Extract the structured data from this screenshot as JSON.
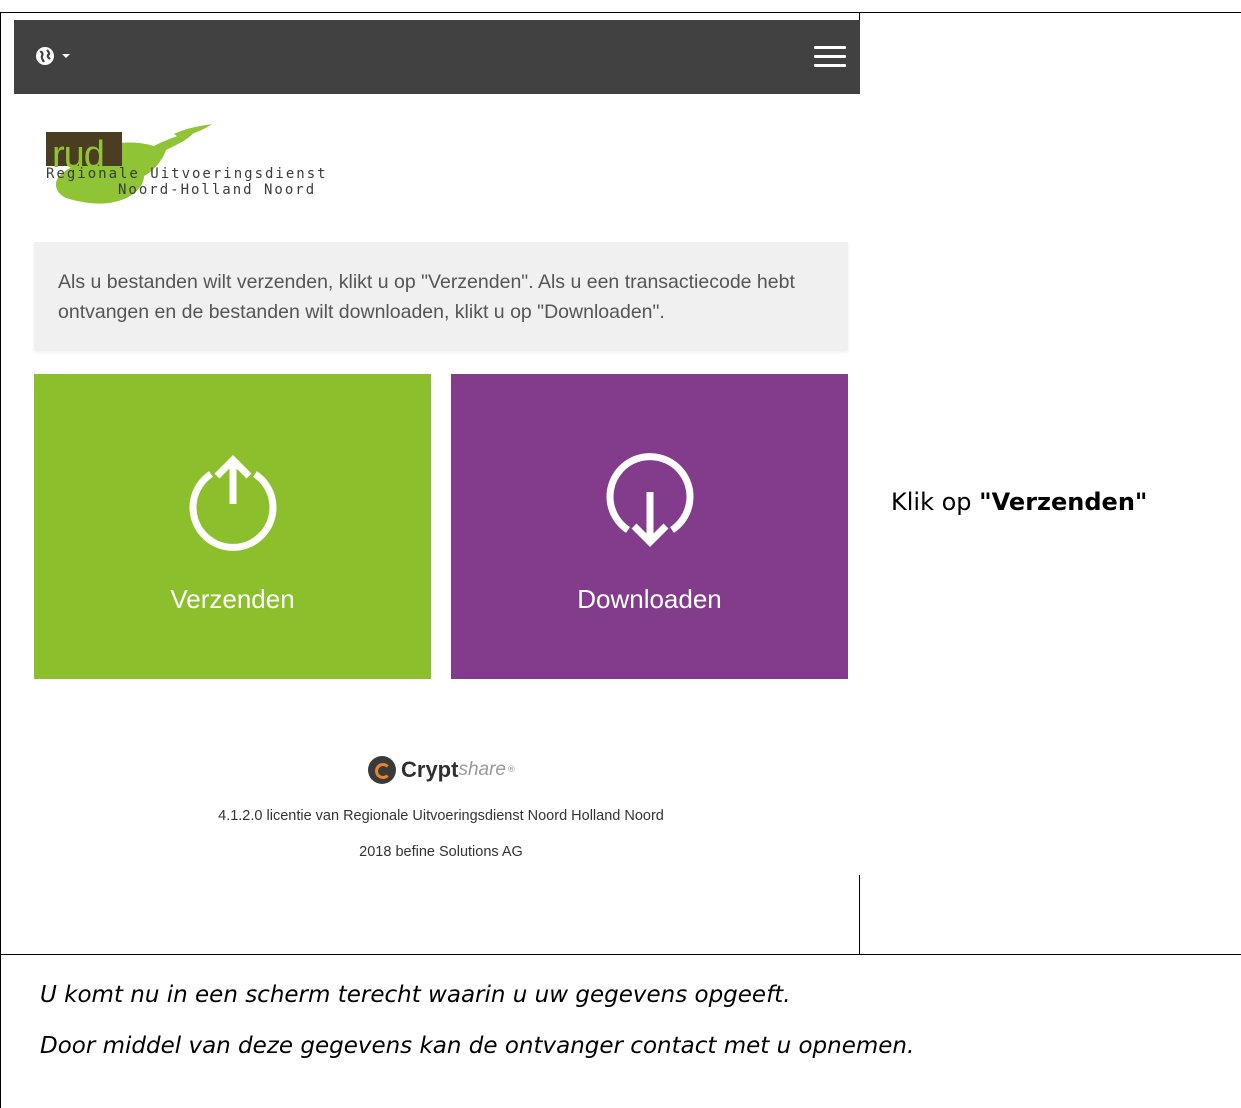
{
  "screenshot": {
    "navbar": {
      "language_icon": "globe-icon",
      "caret_icon": "caret-down-icon",
      "menu_icon": "hamburger-menu-icon"
    },
    "logo": {
      "short": "rud",
      "line1": "Regionale Uitvoeringsdienst",
      "line2": "Noord-Holland Noord"
    },
    "info_text": "Als u bestanden wilt verzenden, klikt u op \"Verzenden\". Als u een transactiecode hebt ontvangen en de bestanden wilt downloaden, klikt u op \"Downloaden\".",
    "tiles": [
      {
        "label": "Verzenden",
        "icon": "upload-icon",
        "color": "#8bbf2b"
      },
      {
        "label": "Downloaden",
        "icon": "download-icon",
        "color": "#833b8c"
      }
    ],
    "footer": {
      "brand_bold": "Crypt",
      "brand_light": "share",
      "brand_mark": "®",
      "license": "4.1.2.0 licentie van Regionale Uitvoeringsdienst Noord Holland Noord",
      "copyright": "2018 befine Solutions AG"
    }
  },
  "instruction": {
    "prefix": "Klik op ",
    "emphasis": "\"Verzenden\""
  },
  "note": {
    "line1": "U komt nu in een scherm terecht waarin u uw gegevens opgeeft.",
    "line2": "Door middel van deze gegevens kan de ontvanger contact met u opnemen."
  }
}
